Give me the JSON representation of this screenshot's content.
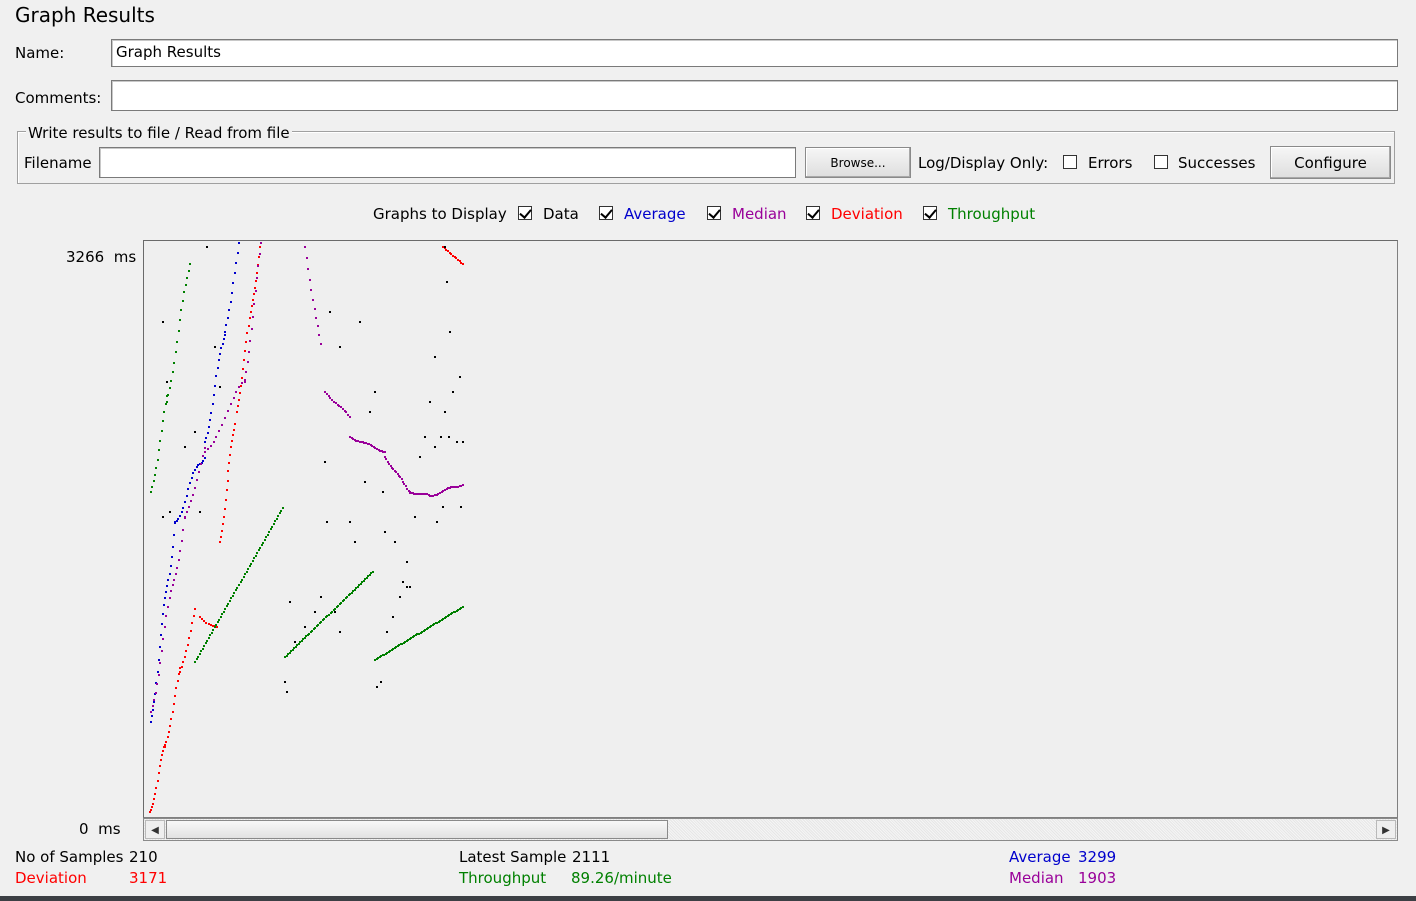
{
  "window_title": "Graph Results",
  "name_label": "Name:",
  "name_value": "Graph Results",
  "comments_label": "Comments:",
  "comments_value": "",
  "file_group": {
    "title": "Write results to file / Read from file",
    "filename_label": "Filename",
    "filename_value": "",
    "browse_label": "Browse...",
    "log_display_label": "Log/Display Only:",
    "errors_label": "Errors",
    "errors_checked": false,
    "successes_label": "Successes",
    "successes_checked": false,
    "configure_label": "Configure"
  },
  "graphs_to_display": {
    "label": "Graphs to Display",
    "options": [
      {
        "label": "Data",
        "checked": true,
        "color": "#000000"
      },
      {
        "label": "Average",
        "checked": true,
        "color": "#0000cc"
      },
      {
        "label": "Median",
        "checked": true,
        "color": "#990099"
      },
      {
        "label": "Deviation",
        "checked": true,
        "color": "#ff0000"
      },
      {
        "label": "Throughput",
        "checked": true,
        "color": "#008000"
      }
    ]
  },
  "axis": {
    "max_label": "3266",
    "max_unit": "ms",
    "min_label": "0",
    "min_unit": "ms"
  },
  "chart_data": {
    "type": "scatter",
    "ylim": [
      0,
      3266
    ],
    "series": [
      {
        "name": "Data",
        "color": "#000000"
      },
      {
        "name": "Average",
        "color": "#0000cc"
      },
      {
        "name": "Median",
        "color": "#990099"
      },
      {
        "name": "Deviation",
        "color": "#ff0000"
      },
      {
        "name": "Throughput",
        "color": "#008000"
      }
    ]
  },
  "stats": {
    "samples_label": "No of Samples",
    "samples_value": "210",
    "deviation_label": "Deviation",
    "deviation_value": "3171",
    "latest_label": "Latest Sample",
    "latest_value": "2111",
    "throughput_label": "Throughput",
    "throughput_value": "89.26/minute",
    "average_label": "Average",
    "average_value": "3299",
    "median_label": "Median",
    "median_value": "1903"
  },
  "colors": {
    "data": "#000000",
    "average": "#0000cc",
    "median": "#990099",
    "deviation": "#ff0000",
    "throughput": "#008000"
  }
}
